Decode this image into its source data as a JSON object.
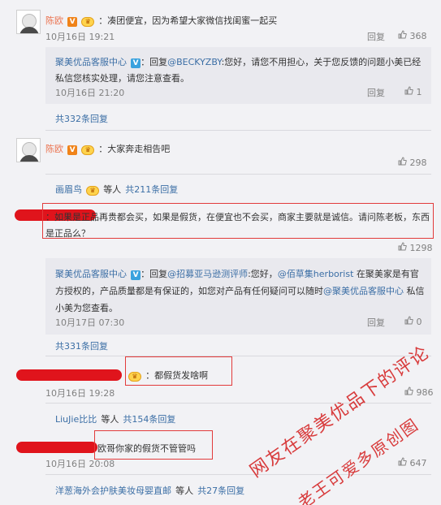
{
  "comments": [
    {
      "user": "陈欧",
      "text": "：凑团便宜，因为希望大家微信找闺蜜一起买",
      "time": "10月16日 19:21",
      "reply_label": "回复",
      "likes": "368",
      "sub_reply": {
        "user": "聚美优品客服中心",
        "text_prefix": "：回复",
        "mention": "@BECKYZBY",
        "text": ":您好，请您不用担心，关于您反馈的问题小美已经私信您核实处理，请您注意查看。",
        "time": "10月16日 21:20",
        "reply_label": "回复",
        "likes": "1"
      },
      "more_replies": "共332条回复"
    },
    {
      "user": "陈欧",
      "text": "：大家奔走相告吧",
      "likes": "298",
      "replier_summary": {
        "user": "画眉鸟",
        "suffix": "等人",
        "count": "共211条回复"
      }
    },
    {
      "text": "：如果是正品再贵都会买，如果是假货，在便宜也不会买，商家主要就是诚信。请问陈老板，东西是正品么？",
      "likes": "1298",
      "sub_reply": {
        "user": "聚美优品客服中心",
        "text_prefix": "：回复",
        "mention": "@招募亚马逊测评师",
        "text_mid": ":您好，",
        "mention2": "@佰草集herborist",
        "text": " 在聚美家是有官方授权的，产品质量都是有保证的，如您对产品有任何疑问可以随时",
        "mention3": "@聚美优品客服中心",
        "text_end": " 私信小美为您查看。",
        "time": "10月17日 07:30",
        "reply_label": "回复",
        "likes": "0"
      },
      "more_replies": "共331条回复"
    },
    {
      "text": "：都假货发啥啊",
      "time": "10月16日 19:28",
      "likes": "986",
      "replier_summary": {
        "user": "LiuJie比比",
        "suffix": "等人",
        "count": "共154条回复"
      }
    },
    {
      "text": "欧哥你家的假货不管管吗",
      "time": "10月16日 20:08",
      "likes": "647",
      "replier_summary": {
        "user": "洋葱海外会护肤美妆母婴直邮",
        "suffix": "等人",
        "count": "共27条回复"
      }
    }
  ],
  "watermark": {
    "line1": "网友在聚美优品下的评论",
    "line2": "老王可爱多原创图"
  },
  "colors": {
    "name_orange": "#eb7350",
    "link_blue": "#3b6ea5",
    "highlight_red": "#e23b3b"
  }
}
